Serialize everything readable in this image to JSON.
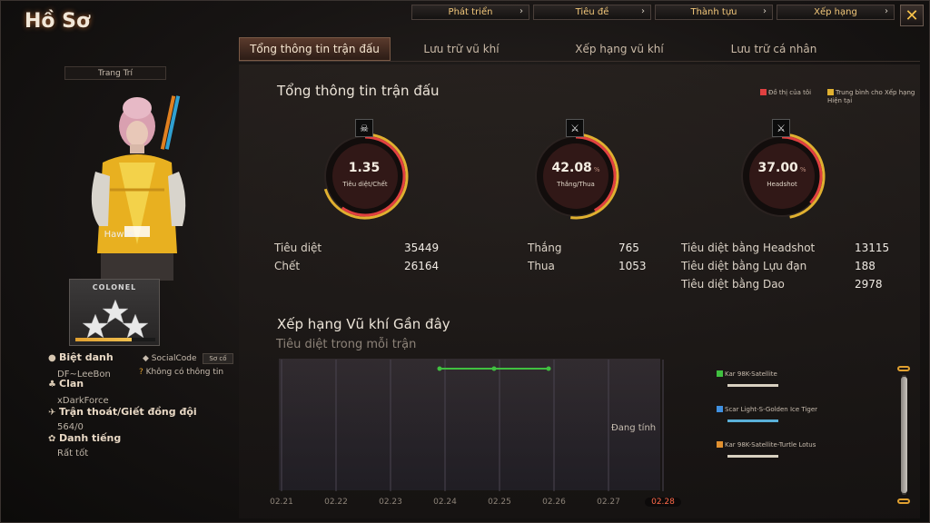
{
  "window": {
    "title": "Hồ Sơ",
    "close_glyph": "✕"
  },
  "top_nav": [
    {
      "label": "Phát triển"
    },
    {
      "label": "Tiêu đề"
    },
    {
      "label": "Thành tựu"
    },
    {
      "label": "Xếp hạng"
    }
  ],
  "tabs": [
    {
      "label": "Tổng thông tin trận đấu",
      "active": true
    },
    {
      "label": "Lưu trữ vũ khí"
    },
    {
      "label": "Xếp hạng vũ khí"
    },
    {
      "label": "Lưu trữ cá nhân"
    }
  ],
  "profile": {
    "decor_button": "Trang Trí",
    "character_name": "Hawks",
    "rank_name": "COLONEL",
    "rank_progress": 0.7,
    "nickname_label": "Biệt danh",
    "nickname": "DF~LeeBon",
    "social_label": "SocialCode",
    "social_button": "Sơ cố",
    "social_value": "Không có thông tin",
    "clan_label": "Clan",
    "clan": "xDarkForce",
    "escape_label": "Trận thoát/Giết đồng đội",
    "escape": "564/0",
    "reputation_label": "Danh tiếng",
    "reputation": "Rất tốt"
  },
  "summary": {
    "title": "Tổng thông tin trận đấu",
    "legend_mine": "Đồ thị của tôi",
    "legend_avg": "Trung bình cho Xếp hạng Hiện tại",
    "colors": {
      "mine": "#e04040",
      "avg": "#e0b030"
    },
    "gauges": [
      {
        "value": "1.35",
        "pct": "",
        "caption": "Tiêu diệt/Chết",
        "icon": "skull-icon",
        "fill": 0.6
      },
      {
        "value": "42.08",
        "pct": "%",
        "caption": "Thắng/Thua",
        "icon": "crossed-guns-icon",
        "fill": 0.42
      },
      {
        "value": "37.00",
        "pct": "%",
        "caption": "Headshot",
        "icon": "knife-gun-icon",
        "fill": 0.37
      }
    ],
    "stats": {
      "kills_label": "Tiêu diệt",
      "kills": "35449",
      "deaths_label": "Chết",
      "deaths": "26164",
      "wins_label": "Thắng",
      "wins": "765",
      "losses_label": "Thua",
      "losses": "1053",
      "hs_label": "Tiêu diệt bằng Headshot",
      "hs": "13115",
      "grenade_label": "Tiêu diệt bằng Lựu đạn",
      "grenade": "188",
      "knife_label": "Tiêu diệt bằng Dao",
      "knife": "2978"
    }
  },
  "weapon_rank": {
    "title": "Xếp hạng Vũ khí Gần đây",
    "subtitle": "Tiêu diệt trong mỗi trận",
    "status": "Đang tính",
    "dates": [
      "02.21",
      "02.22",
      "02.23",
      "02.24",
      "02.25",
      "02.26",
      "02.27",
      "02.28"
    ],
    "active_date": "02.28",
    "weapons": [
      {
        "name": "Kar 98K-Satellite",
        "color": "#40c040"
      },
      {
        "name": "Scar Light-S-Golden Ice Tiger",
        "color": "#4090e0"
      },
      {
        "name": "Kar 98K-Satellite-Turtle Lotus",
        "color": "#e09030"
      }
    ]
  },
  "chart_data": {
    "type": "line",
    "title": "Xếp hạng Vũ khí Gần đây",
    "subtitle": "Tiêu diệt trong mỗi trận",
    "x": [
      "02.21",
      "02.22",
      "02.23",
      "02.24",
      "02.25",
      "02.26",
      "02.27",
      "02.28"
    ],
    "series": [
      {
        "name": "Kar 98K-Satellite",
        "values": [
          null,
          null,
          null,
          null,
          1,
          1,
          1,
          null
        ]
      }
    ]
  }
}
